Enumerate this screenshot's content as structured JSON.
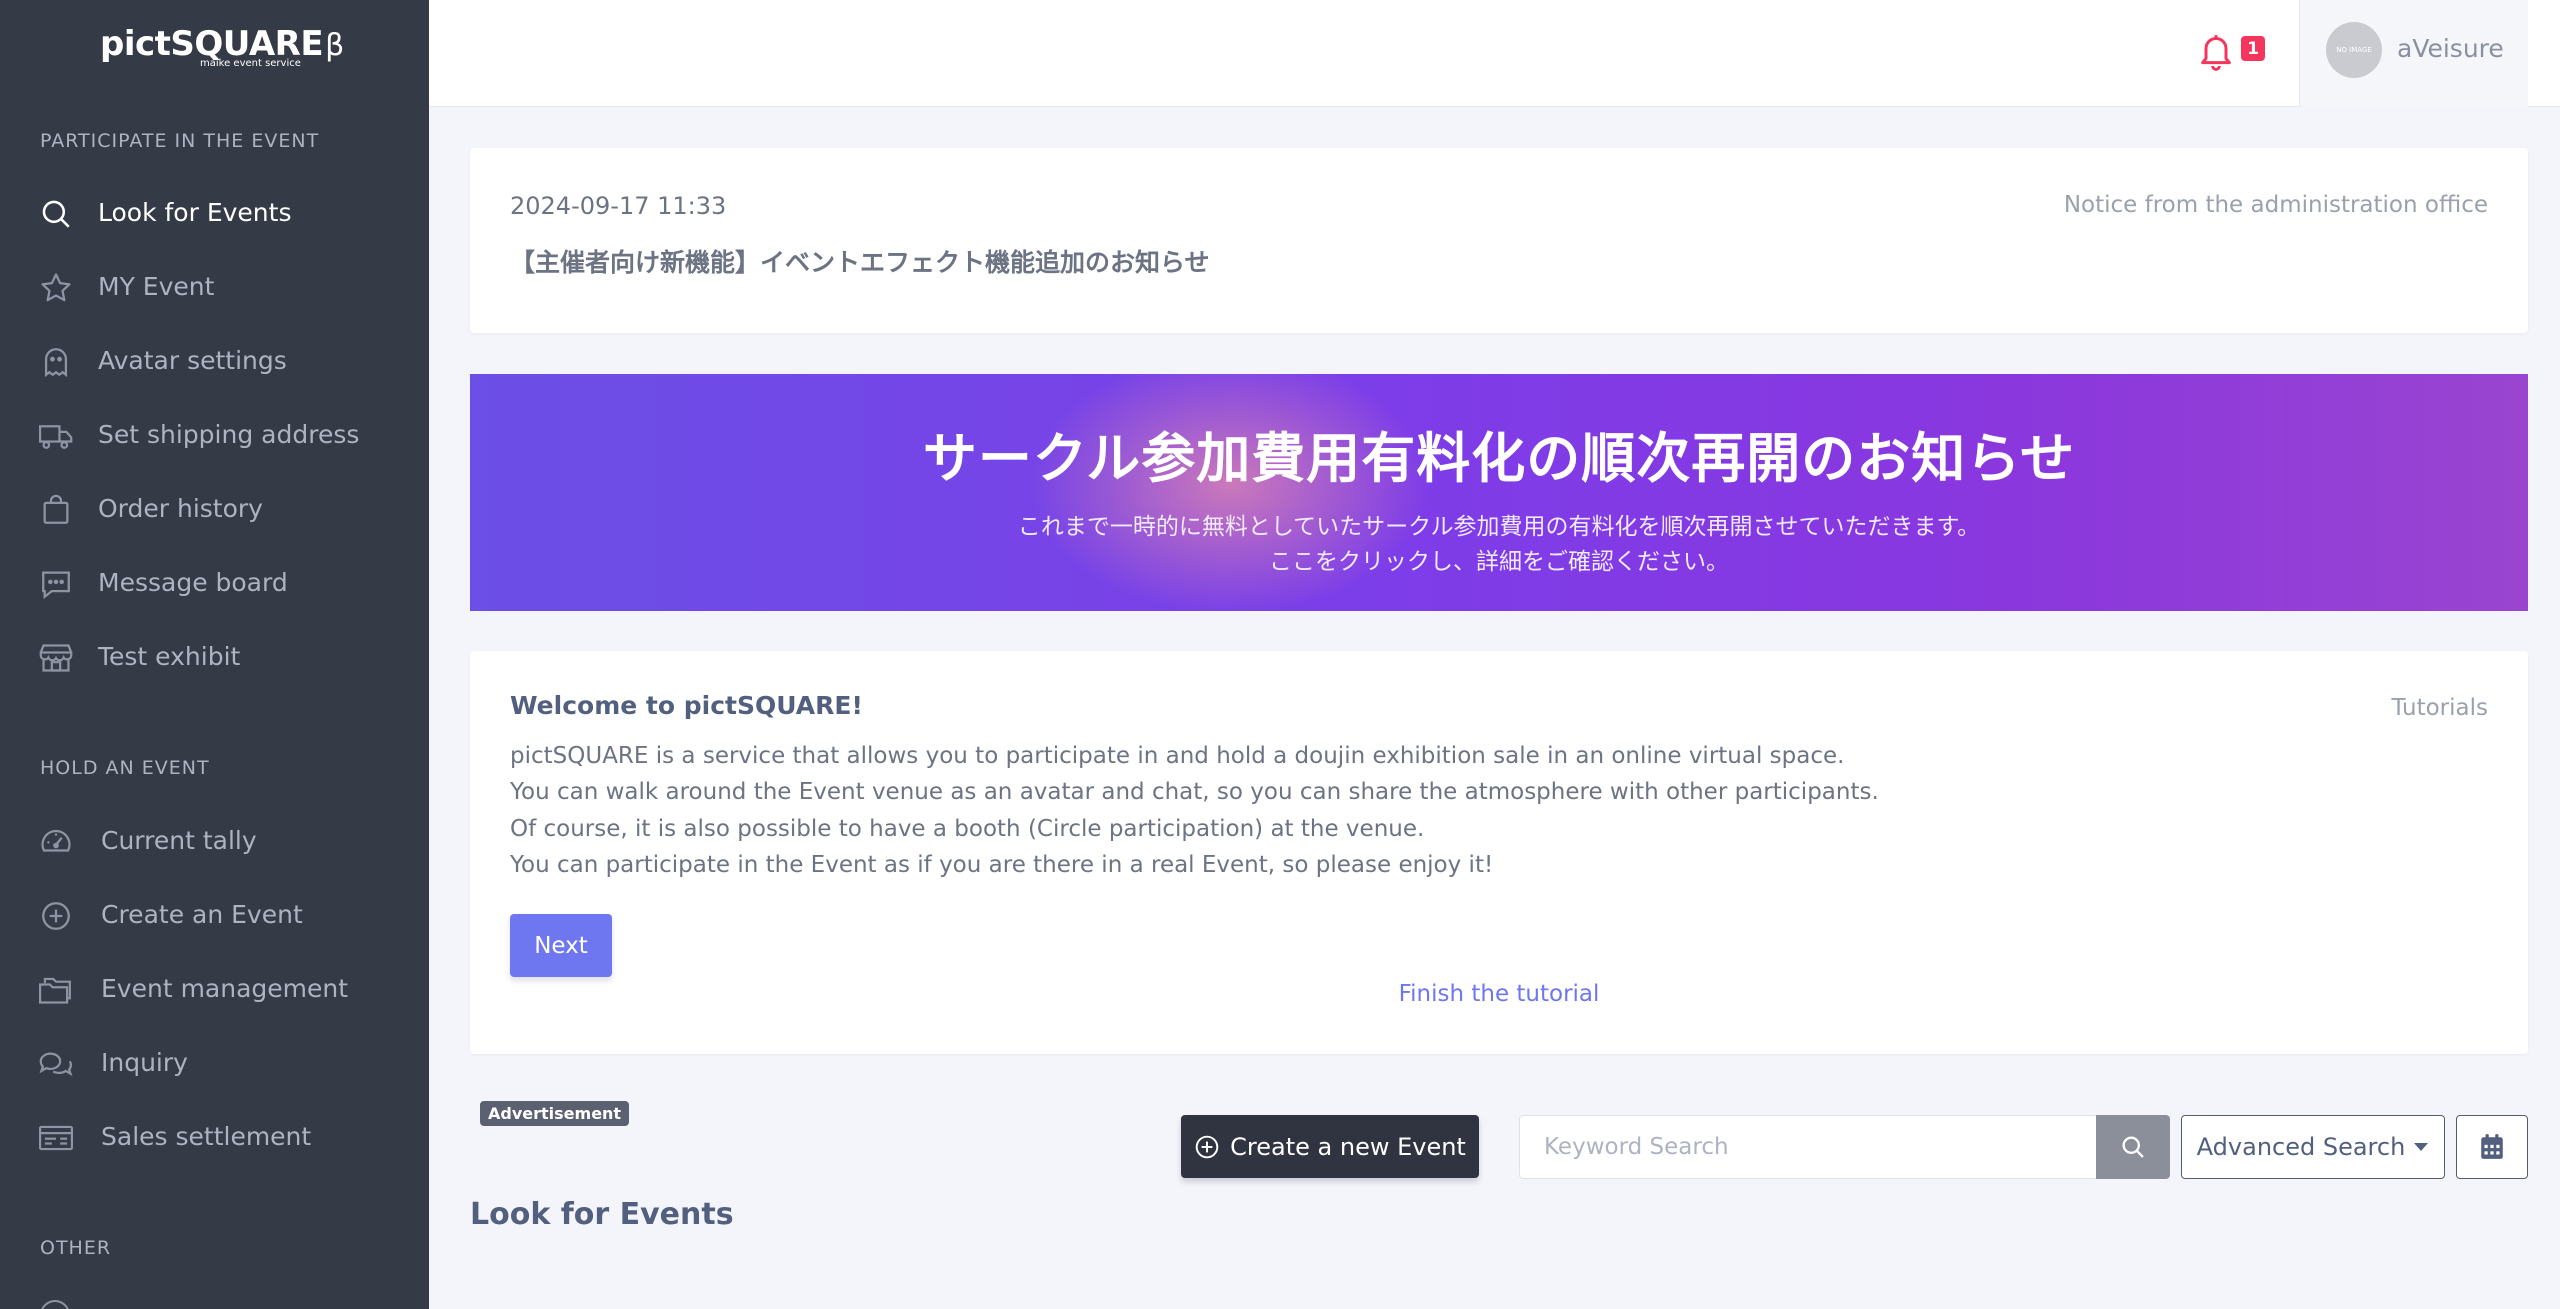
{
  "brand": {
    "name": "pictSQUARE",
    "beta": "β",
    "tagline": "maike event service"
  },
  "sidebar": {
    "section_participate": "PARTICIPATE IN THE EVENT",
    "participate_items": [
      {
        "label": "Look for Events",
        "icon": "search-icon"
      },
      {
        "label": "MY Event",
        "icon": "star-icon"
      },
      {
        "label": "Avatar settings",
        "icon": "ghost-icon"
      },
      {
        "label": "Set shipping address",
        "icon": "truck-icon"
      },
      {
        "label": "Order history",
        "icon": "bag-icon"
      },
      {
        "label": "Message board",
        "icon": "chat-icon"
      },
      {
        "label": "Test exhibit",
        "icon": "store-icon"
      }
    ],
    "section_hold": "HOLD AN EVENT",
    "hold_items": [
      {
        "label": "Current tally",
        "icon": "gauge-icon"
      },
      {
        "label": "Create an Event",
        "icon": "plus-circle-icon"
      },
      {
        "label": "Event management",
        "icon": "folder-icon"
      },
      {
        "label": "Inquiry",
        "icon": "chats-icon"
      },
      {
        "label": "Sales settlement",
        "icon": "receipt-icon"
      }
    ],
    "section_other": "OTHER"
  },
  "topbar": {
    "notification_count": "1",
    "avatar_text": "NO IMAGE",
    "user_name": "aVeisure"
  },
  "notice": {
    "date": "2024-09-17 11:33",
    "title": "【主催者向け新機能】イベントエフェクト機能追加のお知らせ",
    "source": "Notice from the administration office"
  },
  "banner": {
    "title": "サークル参加費用有料化の順次再開のお知らせ",
    "line1": "これまで一時的に無料としていたサークル参加費用の有料化を順次再開させていただきます。",
    "line2": "ここをクリックし、詳細をご確認ください。"
  },
  "tutorial": {
    "heading": "Welcome to pictSQUARE!",
    "link": "Tutorials",
    "lines": [
      "pictSQUARE is a service that allows you to participate in and hold a doujin exhibition sale in an online virtual space.",
      "You can walk around the Event venue as an avatar and chat, so you can share the atmosphere with other participants.",
      "Of course, it is also possible to have a booth (Circle participation) at the venue.",
      "You can participate in the Event as if you are there in a real Event, so please enjoy it!"
    ],
    "next_label": "Next",
    "finish_label": "Finish the tutorial"
  },
  "toolbar": {
    "ad_label": "Advertisement",
    "create_label": "Create a new Event",
    "search_placeholder": "Keyword Search",
    "search_value": "",
    "advanced_label": "Advanced Search"
  },
  "page": {
    "heading": "Look for Events"
  },
  "colors": {
    "sidebar_bg": "#353a47",
    "accent": "#6e76f0",
    "badge": "#f5365c",
    "dark_button": "#2f3440"
  }
}
